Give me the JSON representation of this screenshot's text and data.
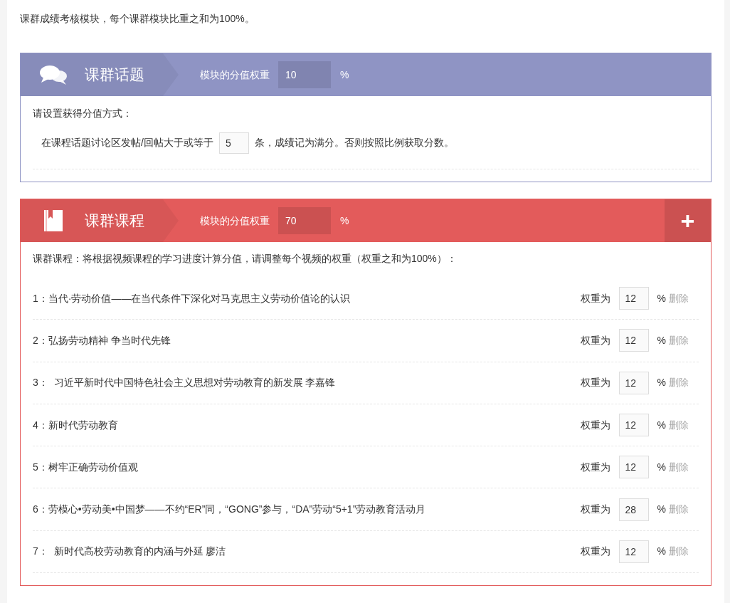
{
  "intro": "课群成绩考核模块，每个课群模块比重之和为100%。",
  "modules": [
    {
      "kind": "topic",
      "title": "课群话题",
      "color": "#8f94c4",
      "weight_label": "模块的分值权重",
      "weight": "10",
      "unit": "%",
      "prompt": "请设置获得分值方式：",
      "text_before": "在课程话题讨论区发帖/回帖大于或等于",
      "count": "5",
      "text_after": "条，成绩记为满分。否则按照比例获取分数。"
    },
    {
      "kind": "course",
      "title": "课群课程",
      "color": "#e35b5b",
      "weight_label": "模块的分值权重",
      "weight": "70",
      "unit": "%",
      "add_button": "+",
      "prompt": "课群课程：将根据视频课程的学习进度计算分值，请调整每个视频的权重（权重之和为100%）：",
      "videos": [
        {
          "label": "1：当代·劳动价值——在当代条件下深化对马克思主义劳动价值论的认识",
          "weight_label": "权重为",
          "weight": "12",
          "unit": "%",
          "delete": "删除"
        },
        {
          "label": "2：弘扬劳动精神 争当时代先锋",
          "weight_label": "权重为",
          "weight": "12",
          "unit": "%",
          "delete": "删除"
        },
        {
          "label": "3：  习近平新时代中国特色社会主义思想对劳动教育的新发展 李嘉锋",
          "weight_label": "权重为",
          "weight": "12",
          "unit": "%",
          "delete": "删除"
        },
        {
          "label": "4：新时代劳动教育",
          "weight_label": "权重为",
          "weight": "12",
          "unit": "%",
          "delete": "删除"
        },
        {
          "label": "5：树牢正确劳动价值观",
          "weight_label": "权重为",
          "weight": "12",
          "unit": "%",
          "delete": "删除"
        },
        {
          "label": "6：劳模心•劳动美•中国梦——不约“ER”同，“GONG”参与，“DA”劳动“5+1”劳动教育活动月",
          "weight_label": "权重为",
          "weight": "28",
          "unit": "%",
          "delete": "删除"
        },
        {
          "label": "7：  新时代高校劳动教育的内涵与外延 廖洁",
          "weight_label": "权重为",
          "weight": "12",
          "unit": "%",
          "delete": "删除"
        }
      ]
    }
  ]
}
